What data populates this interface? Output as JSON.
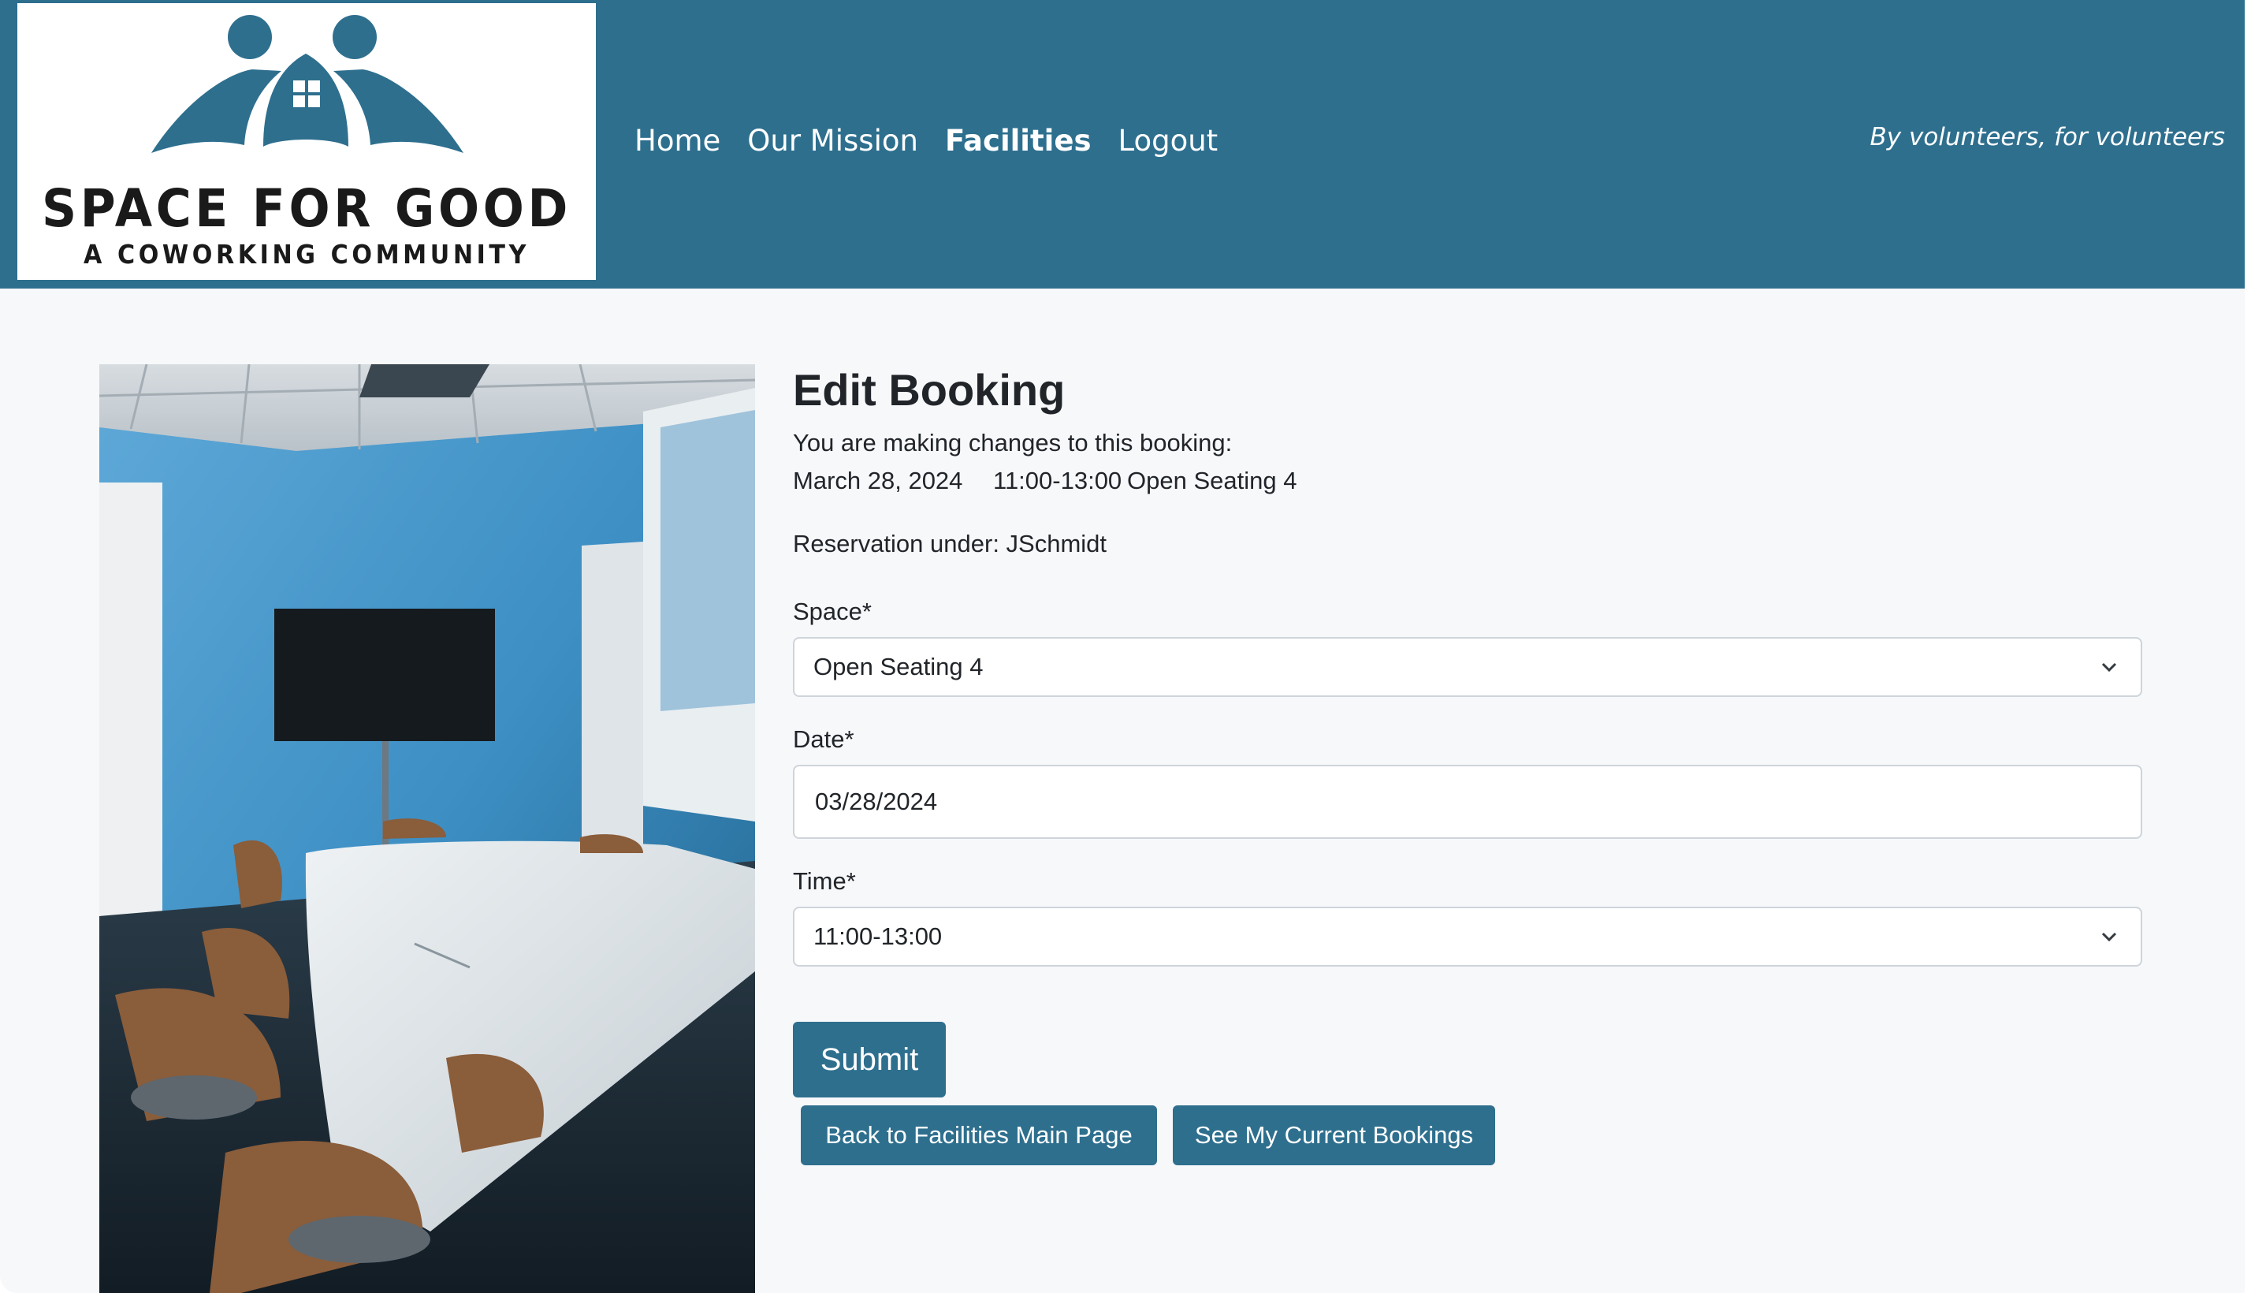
{
  "brand": {
    "logo_line1": "SPACE FOR GOOD",
    "logo_line2": "A COWORKING COMMUNITY",
    "colors": {
      "primary": "#2e6f8e",
      "page_bg": "#f7f8fa",
      "text": "#212529"
    }
  },
  "nav": {
    "items": [
      {
        "label": "Home",
        "active": false
      },
      {
        "label": "Our Mission",
        "active": false
      },
      {
        "label": "Facilities",
        "active": true
      },
      {
        "label": "Logout",
        "active": false
      }
    ],
    "tagline": "By volunteers, for volunteers"
  },
  "booking": {
    "title": "Edit Booking",
    "intro": "You are making changes to this booking:",
    "date": "March 28, 2024",
    "time": "11:00-13:00",
    "space": "Open Seating 4",
    "reservation": "Reservation under: JSchmidt"
  },
  "form": {
    "space_label": "Space*",
    "space_value": "Open Seating 4",
    "date_label": "Date*",
    "date_value": "03/28/2024",
    "time_label": "Time*",
    "time_value": "11:00-13:00",
    "submit_label": "Submit",
    "back_label": "Back to Facilities Main Page",
    "bookings_label": "See My Current Bookings"
  }
}
